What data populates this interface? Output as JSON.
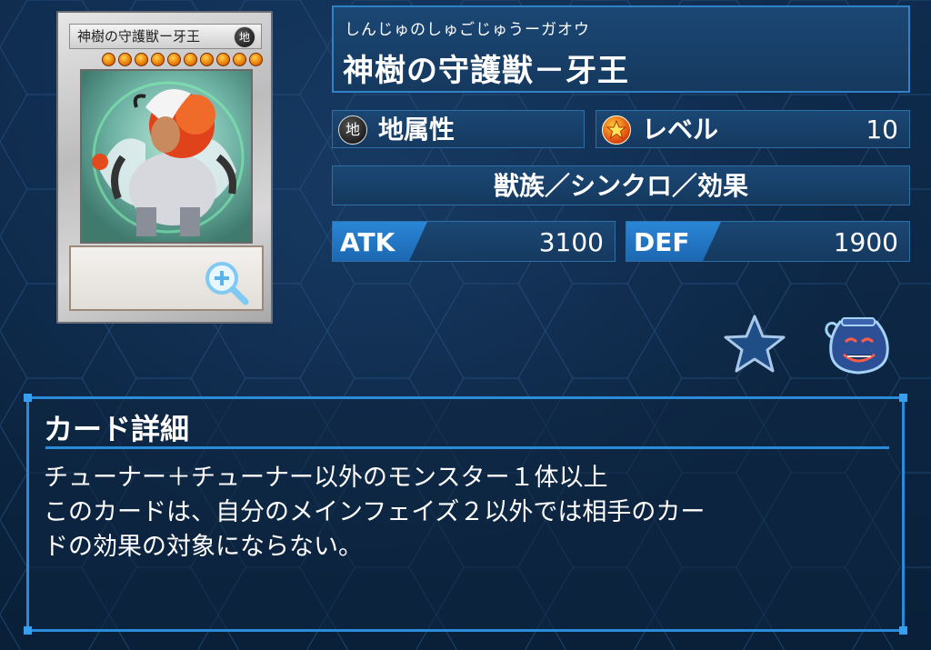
{
  "card_image": {
    "name": "神樹の守護獣ー牙王",
    "attribute_glyph": "地",
    "level_stars": 10,
    "zoom_icon": "zoom-in-icon"
  },
  "header": {
    "reading": "しんじゅのしゅごじゅうーガオウ",
    "name": "神樹の守護獣－牙王"
  },
  "attribute": {
    "icon_glyph": "地",
    "label": "地属性"
  },
  "level": {
    "label": "レベル",
    "value": "10"
  },
  "type_line": "獣族／シンクロ／効果",
  "stats": {
    "atk_label": "ATK",
    "atk_value": "3100",
    "def_label": "DEF",
    "def_value": "1900"
  },
  "actions": {
    "favorite_icon": "star-icon",
    "deck_icon": "pot-of-greed-icon"
  },
  "detail": {
    "title": "カード詳細",
    "lines": [
      "チューナー＋チューナー以外のモンスター１体以上",
      "このカードは、自分のメインフェイズ２以外では相手のカー",
      "ドの効果の対象にならない。"
    ]
  },
  "colors": {
    "accent": "#2a8bd8",
    "panel": "#1b4774",
    "background": "#0c2442"
  }
}
